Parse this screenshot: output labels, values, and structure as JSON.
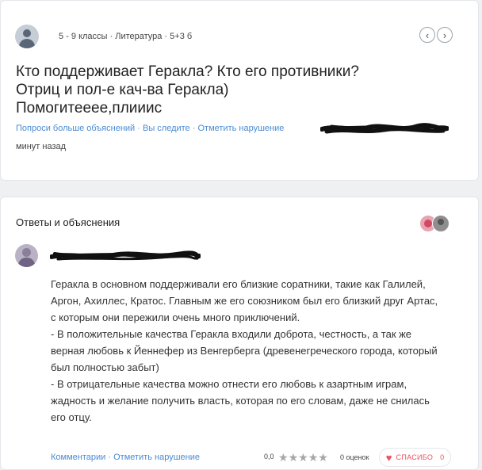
{
  "question": {
    "meta": "5 - 9 классы · Литература · 5+3 б",
    "nav": {
      "prev_icon": "‹",
      "next_icon": "›"
    },
    "text": "Кто поддерживает Геракла? Кто его противники?\nОтриц и пол-е кач-ва Геракла)\nПомогитееее,плиииc",
    "actions": {
      "ask_more": "Попроси больше объяснений",
      "follow": "Вы следите",
      "report": "Отметить нарушение"
    },
    "time": "минут назад"
  },
  "answers": {
    "title": "Ответы и объяснения",
    "answer": {
      "text": "Геракла в основном поддерживали его близкие соратники, такие как Галилей, Аргон, Ахиллес, Кратос. Главным же его союзником был его близкий друг Артас, с которым они пережили очень много приключений.\n - В положительные качества Геракла входили доброта, честность, а так же верная любовь к Йеннефер из Венгерберга (древенегреческого города, который был полностью забыт)\n - В отрицательные качества можно отнести его любовь к азартным играм, жадность и желание получить власть, которая по его словам, даже не снилась его отцу.",
      "comments": "Комментарии",
      "report": "Отметить нарушение",
      "rating": "0,0",
      "stars": 0,
      "rating_count": "0 оценок",
      "thanks_label": "СПАСИБО",
      "thanks_count": "0"
    }
  },
  "colors": {
    "link": "#4a8bd3",
    "thanks": "#ef4e61",
    "star_empty": "#a6a6a6"
  }
}
